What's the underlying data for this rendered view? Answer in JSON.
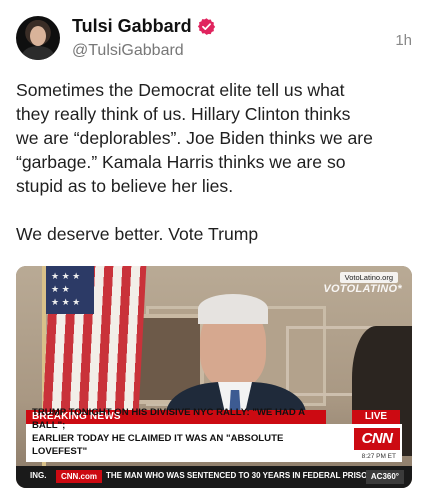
{
  "header": {
    "display_name": "Tulsi Gabbard",
    "handle": "@TulsiGabbard",
    "timestamp": "1h",
    "verified_color": "#e0245e"
  },
  "post": {
    "text": "Sometimes the Democrat elite tell us what\nthey really think of us. Hillary Clinton thinks\nwe are “deplorables”. Joe Biden thinks we are\n“garbage.” Kamala Harris thinks we are so\nstupid as to believe her lies.\n\nWe deserve better. Vote Trump"
  },
  "media": {
    "watermark_small": "VotoLatino.org",
    "watermark_big": "VOTOLATINO",
    "breaking_label": "BREAKING NEWS",
    "live_label": "LIVE",
    "headline": "TRUMP TONIGHT ON HIS DIVISIVE NYC RALLY: \"WE HAD A BALL\";\nEARLIER TODAY HE CLAIMED IT WAS AN \"ABSOLUTE LOVEFEST\"",
    "network_logo": "CNN",
    "network_time": "8:27 PM ET",
    "ticker_left": "ING.",
    "ticker_network": "CNN.com",
    "ticker_text": "THE MAN WHO WAS SENTENCED TO 30 YEARS IN FEDERAL PRISON",
    "ticker_show": "AC360°",
    "brand_red": "#cc0a12"
  }
}
